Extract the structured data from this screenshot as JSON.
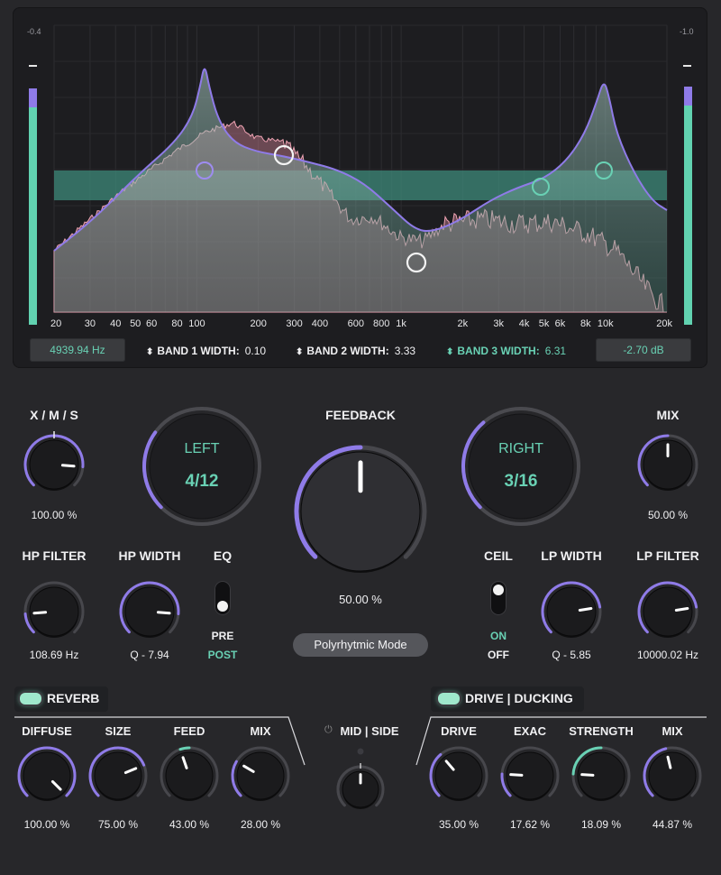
{
  "eq": {
    "meter_left_top": "-0.4",
    "meter_right_top": "-1.0",
    "freq_labels": [
      "20",
      "30",
      "40",
      "50",
      "60",
      "80",
      "100",
      "200",
      "300",
      "400",
      "600",
      "800",
      "1k",
      "2k",
      "3k",
      "4k",
      "5k",
      "6k",
      "8k",
      "10k",
      "20k"
    ],
    "readout_freq": "4939.94 Hz",
    "readout_db": "-2.70 dB",
    "bands": [
      {
        "label": "BAND 1 WIDTH:",
        "value": "0.10"
      },
      {
        "label": "BAND 2 WIDTH:",
        "value": "3.33"
      },
      {
        "label": "BAND 3 WIDTH:",
        "value": "6.31"
      }
    ]
  },
  "colors": {
    "accent": "#8f7be8",
    "teal": "#69d1b4",
    "spectrum": "#e08898",
    "background": "#27272a"
  },
  "controls": {
    "xms": {
      "label": "X / M / S",
      "value": "100.00 %",
      "level": 0.85
    },
    "left": {
      "label": "LEFT",
      "value": "4/12"
    },
    "feedback": {
      "label": "FEEDBACK",
      "value": "50.00 %",
      "level": 0.5
    },
    "right": {
      "label": "RIGHT",
      "value": "3/16"
    },
    "mix": {
      "label": "MIX",
      "value": "50.00 %",
      "level": 0.5
    },
    "hp_filter": {
      "label": "HP FILTER",
      "value": "108.69 Hz"
    },
    "hp_width": {
      "label": "HP WIDTH",
      "value": "Q - 7.94"
    },
    "eq_switch": {
      "label": "EQ",
      "option_top": "PRE",
      "option_bottom": "POST"
    },
    "mode_button": "Polyrhytmic Mode",
    "ceil": {
      "label": "CEIL",
      "option_top": "ON",
      "option_bottom": "OFF"
    },
    "lp_width": {
      "label": "LP WIDTH",
      "value": "Q - 5.85"
    },
    "lp_filter": {
      "label": "LP FILTER",
      "value": "10000.02 Hz"
    }
  },
  "reverb": {
    "title": "REVERB",
    "knobs": [
      {
        "label": "DIFFUSE",
        "value": "100.00 %",
        "level": 1.0
      },
      {
        "label": "SIZE",
        "value": "75.00 %",
        "level": 0.75
      },
      {
        "label": "FEED",
        "value": "43.00 %",
        "level": 0.43
      },
      {
        "label": "MIX",
        "value": "28.00 %",
        "level": 0.28
      }
    ]
  },
  "midside": {
    "label": "MID | SIDE"
  },
  "drive": {
    "title": "DRIVE | DUCKING",
    "knobs": [
      {
        "label": "DRIVE",
        "value": "35.00 %",
        "level": 0.35
      },
      {
        "label": "EXAC",
        "value": "17.62 %",
        "level": 0.18
      },
      {
        "label": "STRENGTH",
        "value": "18.09 %",
        "level": 0.18
      },
      {
        "label": "MIX",
        "value": "44.87 %",
        "level": 0.45
      }
    ]
  }
}
